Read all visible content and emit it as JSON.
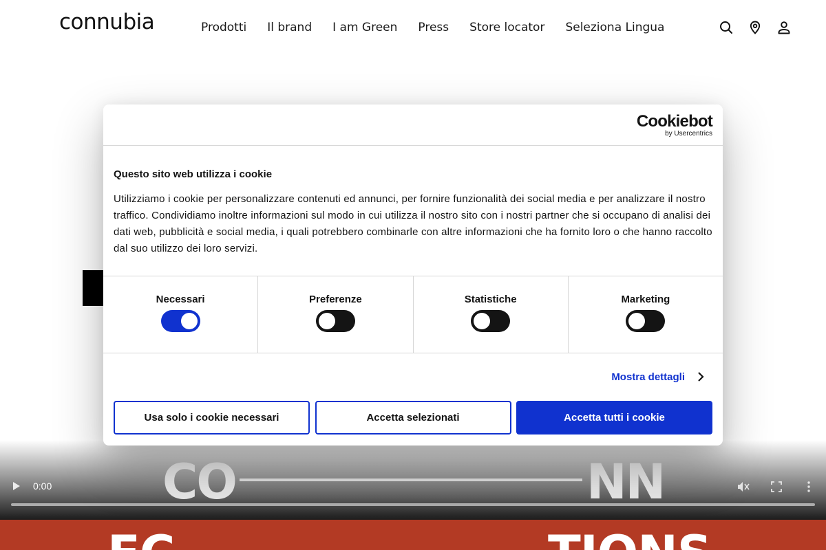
{
  "header": {
    "logo": "connubia",
    "nav": [
      "Prodotti",
      "Il brand",
      "I am Green",
      "Press",
      "Store locator",
      "Seleziona Lingua"
    ],
    "icons": [
      "search-icon",
      "location-pin-icon",
      "user-icon"
    ]
  },
  "cookie_dialog": {
    "brand": "Cookiebot",
    "brand_sub": "by Usercentrics",
    "title": "Questo sito web utilizza i cookie",
    "text": "Utilizziamo i cookie per personalizzare contenuti ed annunci, per fornire funzionalità dei social media e per analizzare il nostro traffico. Condividiamo inoltre informazioni sul modo in cui utilizza il nostro sito con i nostri partner che si occupano di analisi dei dati web, pubblicità e social media, i quali potrebbero combinarle con altre informazioni che ha fornito loro o che hanno raccolto dal suo utilizzo dei loro servizi.",
    "categories": [
      {
        "label": "Necessari",
        "enabled": true
      },
      {
        "label": "Preferenze",
        "enabled": false
      },
      {
        "label": "Statistiche",
        "enabled": false
      },
      {
        "label": "Marketing",
        "enabled": false
      }
    ],
    "details_link": "Mostra dettagli",
    "buttons": {
      "necessary_only": "Usa solo i cookie necessari",
      "accept_selected": "Accetta selezionati",
      "accept_all": "Accetta tutti i cookie"
    },
    "accent_color": "#1032cf"
  },
  "video": {
    "time": "0:00",
    "text_left": "CO",
    "text_right": "NN"
  },
  "banner": {
    "text_left": "EC",
    "text_right": "TIONS",
    "color": "#b33a24"
  }
}
